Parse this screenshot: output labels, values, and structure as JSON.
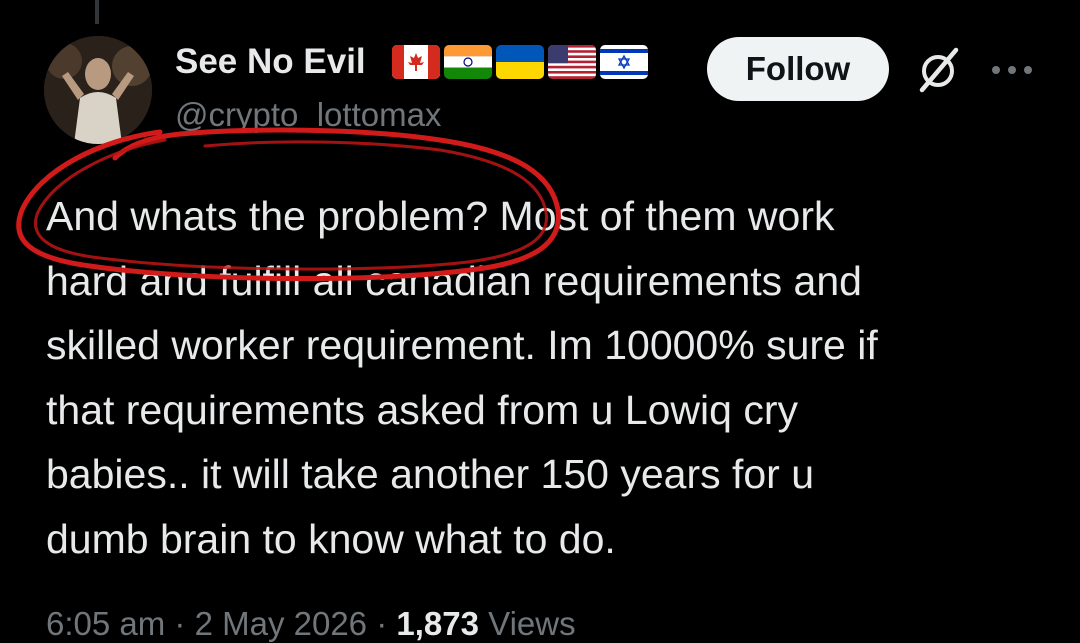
{
  "author": {
    "display_name": "See No Evil",
    "handle": "@crypto_lottomax",
    "flags": [
      "canada-flag",
      "india-flag",
      "ukraine-flag",
      "usa-flag",
      "israel-flag"
    ]
  },
  "actions": {
    "follow_label": "Follow",
    "grok_icon": "grok-icon",
    "more_icon": "more-icon"
  },
  "tweet": {
    "lines": [
      "And whats the problem? Most of them work",
      "hard and fulfill all canadian requirements and",
      "skilled worker requirement. Im 10000% sure if",
      "that requirements asked from u Lowiq cry",
      "babies.. it will take another 150 years for u",
      "dumb brain to know what to do."
    ]
  },
  "meta": {
    "time": "6:05 am",
    "separator": "·",
    "date": "2 May 2026",
    "views_count": "1,873",
    "views_label": "Views"
  },
  "colors": {
    "background": "#000000",
    "text_primary": "#e7e9ea",
    "text_secondary": "#71767b",
    "annotation_red": "#d11a1a"
  }
}
